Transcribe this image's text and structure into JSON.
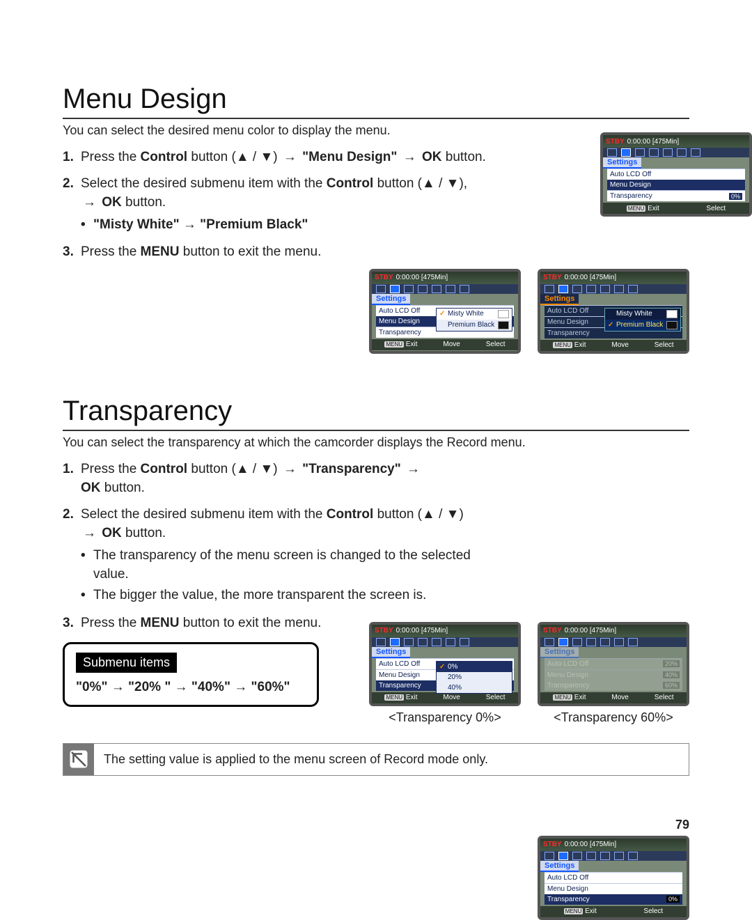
{
  "page_number": "79",
  "arrow": "→",
  "tri_up": "▲",
  "tri_down": "▼",
  "section1": {
    "title": "Menu Design",
    "intro": "You can select the desired menu color to display the menu.",
    "step1_a": "Press the ",
    "step1_b": "Control",
    "step1_c": " button (",
    "step1_d": ") ",
    "step1_e": "\"Menu Design\"",
    "step1_f": "OK",
    "step1_g": " button.",
    "step2_a": "Select the desired submenu item with the ",
    "step2_b": "Control",
    "step2_c": " button (",
    "step2_d": "), ",
    "step2_e": "OK",
    "step2_f": " button.",
    "step2_bullet": "\"Misty White\" → \"Premium Black\"",
    "step3_a": "Press the ",
    "step3_b": "MENU",
    "step3_c": " button to exit the menu."
  },
  "section2": {
    "title": "Transparency",
    "intro": "You can select the transparency at which the camcorder displays the Record menu.",
    "step1_a": "Press the ",
    "step1_b": "Control",
    "step1_c": " button (",
    "step1_d": ") ",
    "step1_e": "\"Transparency\"",
    "step1_f": "OK",
    "step1_g": " button.",
    "step2_a": "Select the desired submenu item with the ",
    "step2_b": "Control",
    "step2_c": " button (",
    "step2_d": ") ",
    "step2_e": "OK",
    "step2_f": " button.",
    "step2_b1": "The transparency of the menu screen is changed to the selected value.",
    "step2_b2": "The bigger the value, the more transparent the screen is.",
    "step3_a": "Press the ",
    "step3_b": "MENU",
    "step3_c": " button to exit the menu."
  },
  "submenu_box": {
    "header": "Submenu items",
    "items": "\"0%\" → \"20% \" → \"40%\" → \"60%\""
  },
  "note": "The setting value is applied to the menu screen of Record mode only.",
  "lcd": {
    "stby": "STBY",
    "time": "0:00:00 [475Min]",
    "settings": "Settings",
    "auto_lcd": "Auto LCD Off",
    "menu_design": "Menu Design",
    "transparency": "Transparency",
    "val0": "0%",
    "exit_tag": "MENU",
    "exit": "Exit",
    "move": "Move",
    "select": "Select",
    "misty": "Misty White",
    "premium": "Premium Black",
    "p0": "0%",
    "p20": "20%",
    "p40": "40%",
    "p60": "60%",
    "cap0": "<Transparency 0%>",
    "cap60": "<Transparency 60%>"
  },
  "nums": {
    "n1": "1.",
    "n2": "2.",
    "n3": "3."
  }
}
